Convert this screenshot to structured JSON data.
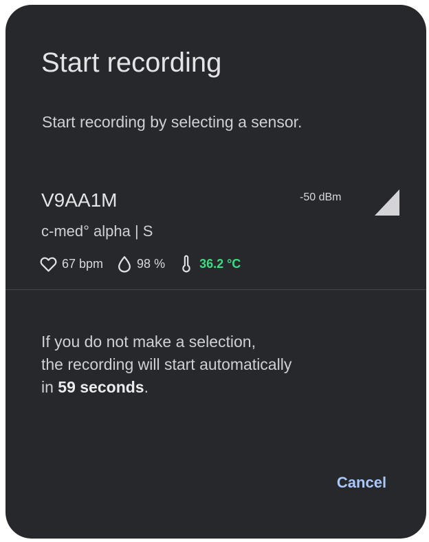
{
  "dialog": {
    "title": "Start recording",
    "subtitle": "Start recording by selecting a sensor."
  },
  "sensor": {
    "name": "V9AA1M",
    "model": "c-med° alpha | S",
    "signal": "-50 dBm",
    "signal_icon": "signal-strength-icon",
    "heart_rate": "67 bpm",
    "heart_rate_icon": "heart-icon",
    "spo2": "98 %",
    "spo2_icon": "drop-icon",
    "temperature": "36.2 °C",
    "temperature_icon": "thermometer-icon",
    "temperature_color": "#3ddc84"
  },
  "notice": {
    "line1": "If you do not make a selection,",
    "line2": "the recording will start automatically",
    "line3_prefix": "in ",
    "countdown": "59 seconds",
    "line3_suffix": "."
  },
  "actions": {
    "cancel_label": "Cancel",
    "accent_color": "#a8c7fa"
  }
}
